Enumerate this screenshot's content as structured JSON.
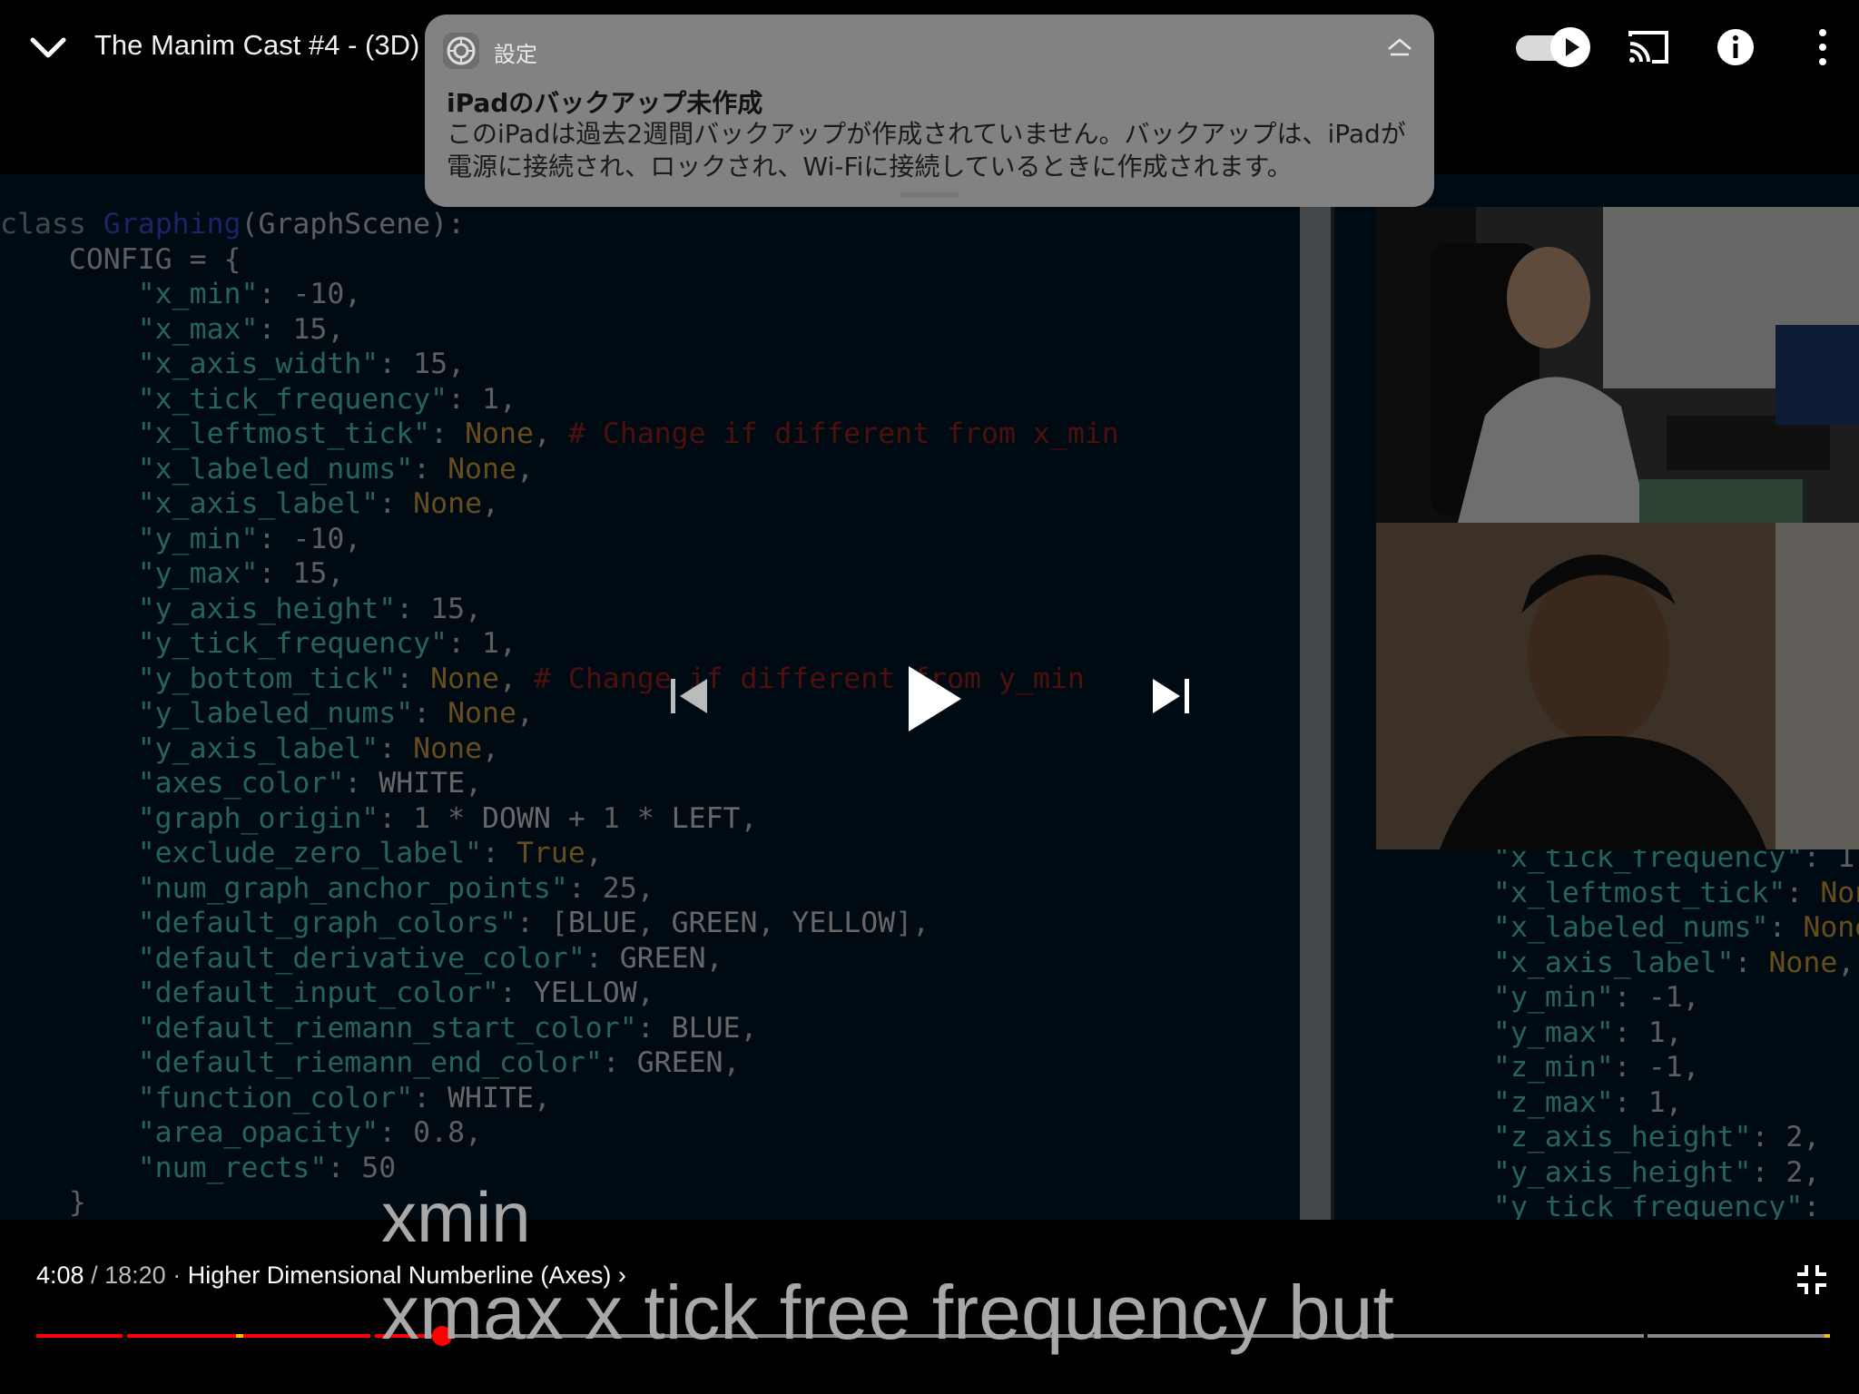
{
  "header": {
    "title": "The Manim Cast #4 - (3D)"
  },
  "notification": {
    "app": "設定",
    "title": "iPadのバックアップ未作成",
    "body": "このiPadは過去2週間バックアップが作成されていません。バックアップは、iPadが電源に接続され、ロックされ、Wi-Fiに接続しているときに作成されます。"
  },
  "player": {
    "current_time": "4:08",
    "separator": "/",
    "duration": "18:20",
    "chapter": "Higher Dimensional Numberline (Axes)",
    "chapter_arrow": "›",
    "progress_fraction": 0.226
  },
  "captions": {
    "line1": "xmin",
    "line2": "xmax x tick free frequency but"
  },
  "colors": {
    "progress_played": "#ff0000",
    "progress_unplayed": "#8a8a8a",
    "chapter_marker": "#f5c400",
    "video_bg": "#001628"
  },
  "icons": {
    "collapse": "chevron-down-icon",
    "autoplay": "autoplay-toggle-icon",
    "cast": "cast-icon",
    "info": "info-icon",
    "more": "more-vertical-icon",
    "prev": "skip-previous-icon",
    "play": "play-icon",
    "next": "skip-next-icon",
    "fullscreen": "exit-fullscreen-icon",
    "settings_app": "settings-gear-icon",
    "notification_expand": "expand-icon"
  }
}
